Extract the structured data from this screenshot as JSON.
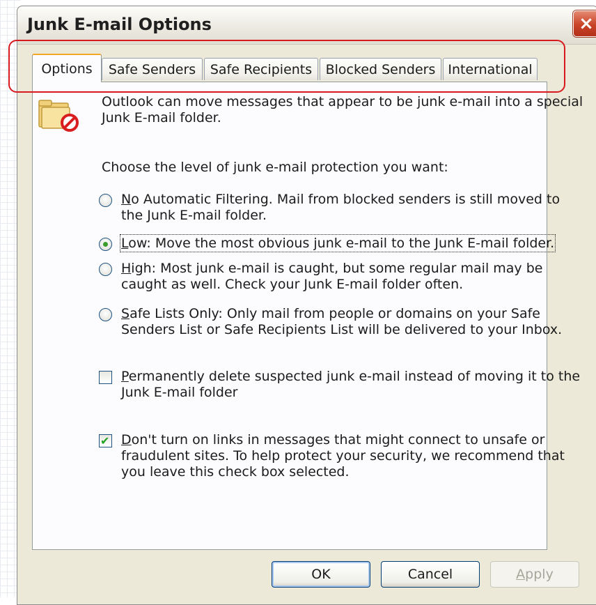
{
  "window": {
    "title": "Junk E-mail Options",
    "close_label": "×"
  },
  "tabs": [
    {
      "label": "Options",
      "active": true
    },
    {
      "label": "Safe Senders",
      "active": false
    },
    {
      "label": "Safe Recipients",
      "active": false
    },
    {
      "label": "Blocked Senders",
      "active": false
    },
    {
      "label": "International",
      "active": false
    }
  ],
  "options": {
    "intro_line1": "Outlook can move messages that appear to be junk e-mail into a special",
    "intro_line2": "Junk E-mail folder.",
    "choose_label": "Choose the level of junk e-mail protection you want:",
    "radios": [
      {
        "key": "N",
        "line1_rest": "o Automatic Filtering.  Mail from blocked senders is still moved to",
        "line2": "the Junk E-mail folder.",
        "checked": false
      },
      {
        "key": "L",
        "line1_rest": "ow: Move the most obvious junk e-mail to the Junk E-mail folder.",
        "line2": "",
        "checked": true
      },
      {
        "key": "H",
        "line1_rest": "igh: Most junk e-mail is caught, but some regular mail may be",
        "line2": "caught as well. Check your Junk E-mail folder often.",
        "checked": false
      },
      {
        "key": "S",
        "line1_rest": "afe Lists Only: Only mail from people or domains on your Safe",
        "line2": "Senders List or Safe Recipients List will be delivered to your Inbox.",
        "checked": false
      }
    ],
    "checkboxes": [
      {
        "key": "P",
        "line1_rest": "ermanently delete suspected junk e-mail instead of moving it to the",
        "line2": "Junk E-mail folder",
        "line3": "",
        "checked": false
      },
      {
        "key": "D",
        "line1_rest": "on't turn on links in messages that might connect to unsafe or",
        "line2": "fraudulent sites.  To help protect your security, we recommend that",
        "line3": "you leave this check box selected.",
        "checked": true
      }
    ]
  },
  "buttons": {
    "ok": "OK",
    "cancel": "Cancel",
    "apply_key": "A",
    "apply_rest": "pply"
  },
  "colors": {
    "dialog_bg": "#ece9d8",
    "panel_bg": "#fcfcfe",
    "annotation_red": "#d8191d",
    "active_tab_accent": "#f5a623",
    "check_green": "#21a121"
  }
}
